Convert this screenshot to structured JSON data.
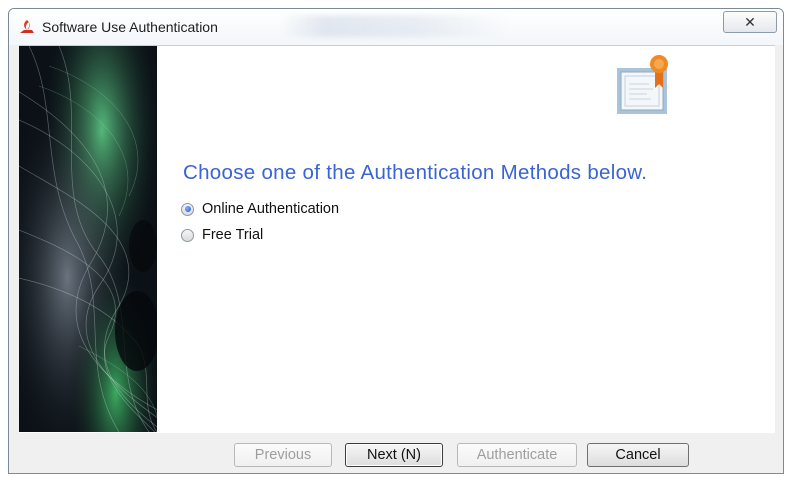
{
  "window": {
    "title": "Software Use Authentication",
    "close_glyph": "✕"
  },
  "main": {
    "heading": "Choose one of the Authentication Methods below.",
    "options": [
      {
        "label": "Online Authentication",
        "checked": true
      },
      {
        "label": "Free Trial",
        "checked": false
      }
    ]
  },
  "footer": {
    "previous_label": "Previous",
    "next_label": "Next (N)",
    "authenticate_label": "Authenticate",
    "cancel_label": "Cancel"
  },
  "icons": {
    "app": "app-logo-icon",
    "certificate": "certificate-icon",
    "close": "close-icon"
  },
  "colors": {
    "heading": "#3a64d6",
    "ribbon": "#f08a24"
  }
}
